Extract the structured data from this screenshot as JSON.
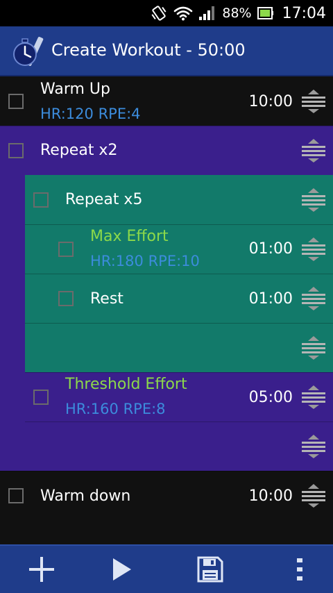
{
  "status": {
    "battery_pct": "88%",
    "time": "17:04",
    "icons": [
      "vibrate-icon",
      "wifi-icon",
      "signal-icon",
      "battery-icon"
    ]
  },
  "header": {
    "title": "Create Workout - 50:00",
    "icon": "stopwatch-app-icon"
  },
  "colors": {
    "statusbar": "#000000",
    "actionbar": "#1f3c8a",
    "repeat_outer": "#3a1f8c",
    "repeat_inner": "#127a6a",
    "effort_green": "#8cd94a",
    "hr_blue": "#3c8cdc",
    "dark_row": "#111111"
  },
  "items": [
    {
      "title": "Warm Up",
      "detail": "HR:120 RPE:4",
      "duration": "10:00"
    },
    {
      "title": "Repeat x2"
    },
    {
      "title": "Repeat x5"
    },
    {
      "title": "Max Effort",
      "detail": "HR:180 RPE:10",
      "duration": "01:00"
    },
    {
      "title": "Rest",
      "duration": "01:00"
    },
    {
      "title": ""
    },
    {
      "title": "Threshold Effort",
      "detail": "HR:160 RPE:8",
      "duration": "05:00"
    },
    {
      "title": ""
    },
    {
      "title": "Warm down",
      "duration": "10:00"
    }
  ],
  "toolbar": {
    "buttons": [
      "add-icon",
      "play-icon",
      "save-icon",
      "overflow-menu-icon"
    ]
  }
}
